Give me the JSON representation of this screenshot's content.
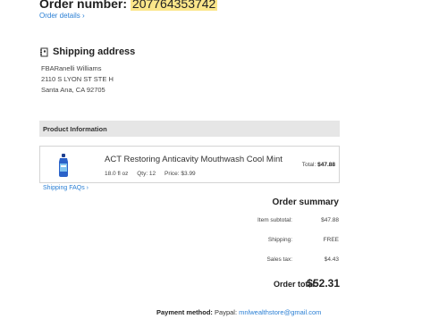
{
  "order": {
    "number_label": "Order number:",
    "number": "207764353742",
    "details_link": "Order details ›"
  },
  "shipping": {
    "title": "Shipping address",
    "line1": "FBARanelli  Williams",
    "line2": "2110 S LYON ST STE H",
    "line3": "Santa Ana,  CA 92705"
  },
  "product_section": {
    "header": "Product Information",
    "item": {
      "name": "ACT Restoring Anticavity Mouthwash Cool Mint",
      "size": "18.0 fl oz",
      "qty": "Qty: 12",
      "price": "Price: $3.99",
      "total_label": "Total:",
      "total_value": "$47.88"
    },
    "faq_link": "Shipping FAQs ›"
  },
  "summary": {
    "title": "Order summary",
    "rows": [
      {
        "label": "Item subtotal:",
        "value": "$47.88"
      },
      {
        "label": "Shipping:",
        "value": "FREE"
      },
      {
        "label": "Sales tax:",
        "value": "$4.43"
      }
    ],
    "total_label": "Order total:",
    "total_value": "$52.31"
  },
  "payment": {
    "label": "Payment method:",
    "method": "Paypal:",
    "email": "mnlwealthstore@gmail.com"
  },
  "colors": {
    "link": "#2a7fd4",
    "highlight": "#fbe68a",
    "section_bg": "#e6e6e6"
  }
}
